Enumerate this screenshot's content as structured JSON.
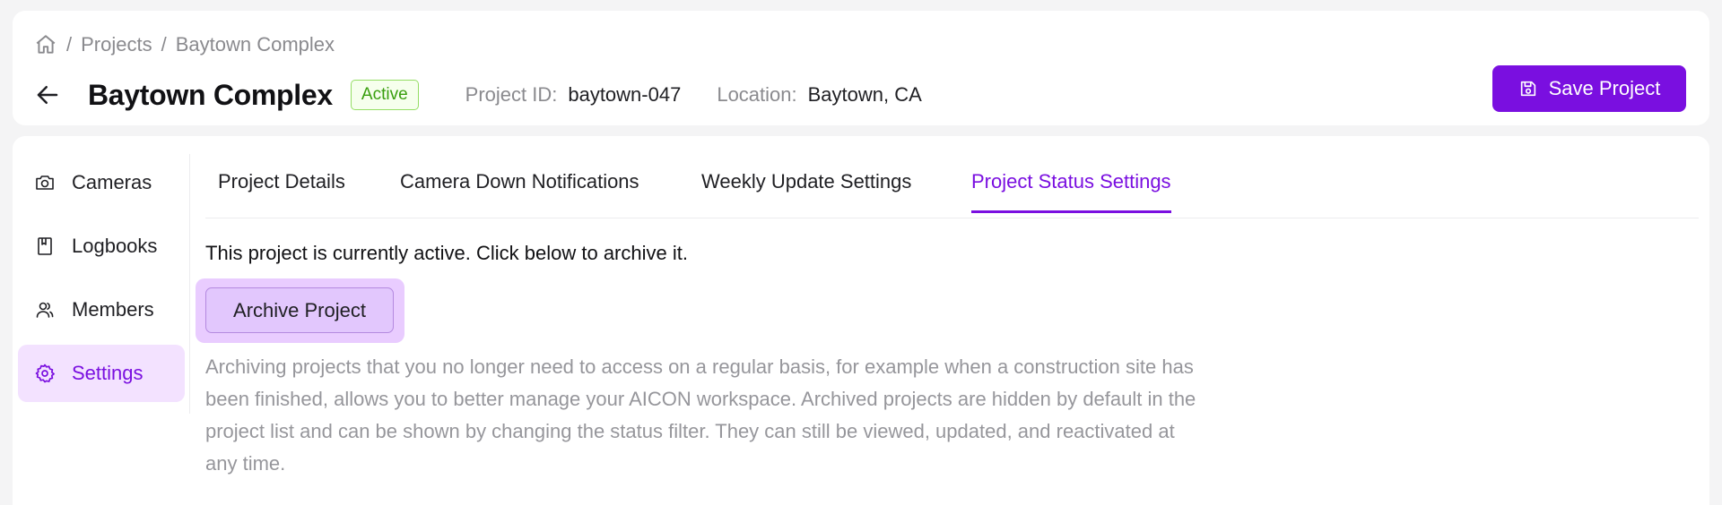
{
  "breadcrumb": {
    "home_icon": "home-icon",
    "separator": "/",
    "items": [
      "Projects",
      "Baytown Complex"
    ]
  },
  "project": {
    "title": "Baytown Complex",
    "status": "Active",
    "id_label": "Project ID:",
    "id_value": "baytown-047",
    "location_label": "Location:",
    "location_value": "Baytown, CA"
  },
  "actions": {
    "save_label": "Save Project",
    "save_icon": "save-icon"
  },
  "sidebar": {
    "items": [
      {
        "label": "Cameras",
        "icon": "camera-icon",
        "active": false
      },
      {
        "label": "Logbooks",
        "icon": "book-icon",
        "active": false
      },
      {
        "label": "Members",
        "icon": "users-icon",
        "active": false
      },
      {
        "label": "Settings",
        "icon": "gear-icon",
        "active": true
      }
    ]
  },
  "tabs": [
    {
      "label": "Project Details",
      "active": false
    },
    {
      "label": "Camera Down Notifications",
      "active": false
    },
    {
      "label": "Weekly Update Settings",
      "active": false
    },
    {
      "label": "Project Status Settings",
      "active": true
    }
  ],
  "status_settings": {
    "intro": "This project is currently active. Click below to archive it.",
    "archive_label": "Archive Project",
    "description": "Archiving projects that you no longer need to access on a regular basis, for example when a construction site has been finished, allows you to better manage your AICON workspace. Archived projects are hidden by default in the project list and can be shown by changing the status filter. They can still be viewed, updated, and reactivated at any time."
  },
  "colors": {
    "accent": "#7a0fe0",
    "accent_soft": "#f3e2ff",
    "status_green": "#389e0d",
    "muted_text": "#8a8a8e"
  }
}
